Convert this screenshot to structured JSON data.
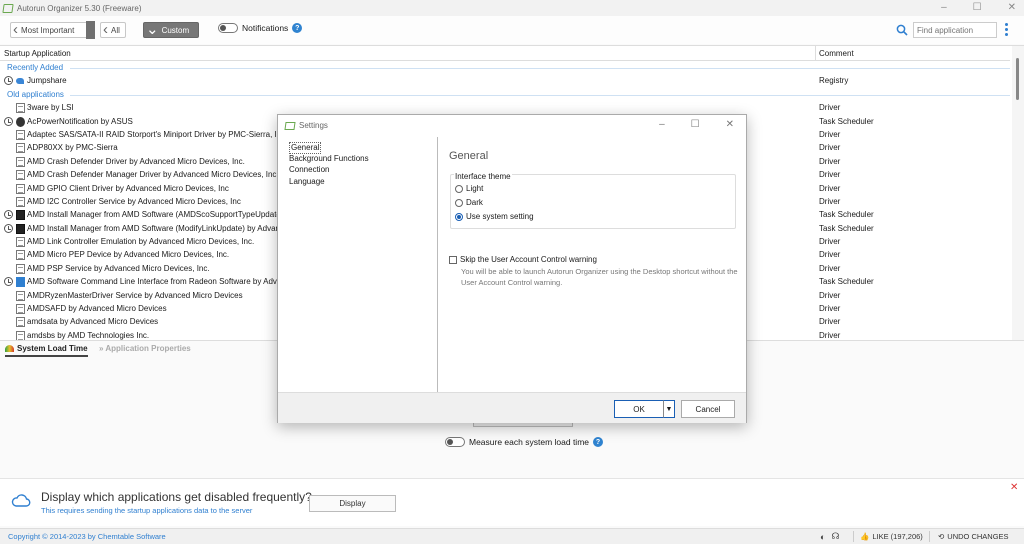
{
  "window": {
    "title": "Autorun Organizer 5.30 (Freeware)",
    "controls": [
      "–",
      "☐",
      "✕"
    ]
  },
  "toolbar": {
    "breadcrumbs": [
      "Most Important",
      "All",
      "Custom"
    ],
    "notifications_label": "Notifications",
    "help_glyph": "?",
    "search_placeholder": "Find application"
  },
  "list": {
    "columns": {
      "name": "Startup Application",
      "comment": "Comment"
    },
    "groups": {
      "recent": "Recently Added",
      "old": "Old applications"
    },
    "recent_items": [
      {
        "name": "Jumpshare",
        "comment": "Registry",
        "icon": "share-icon",
        "clock": true
      }
    ],
    "old_items": [
      {
        "name": "3ware by LSI",
        "comment": "Driver",
        "icon": "file-icon",
        "clock": false
      },
      {
        "name": "AcPowerNotification by ASUS",
        "comment": "Task Scheduler",
        "icon": "hex-icon",
        "clock": true
      },
      {
        "name": "Adaptec SAS/SATA-II RAID Storport's Miniport Driver by PMC-Sierra, Inc.",
        "comment": "Driver",
        "icon": "file-icon",
        "clock": false
      },
      {
        "name": "ADP80XX by PMC-Sierra",
        "comment": "Driver",
        "icon": "file-icon",
        "clock": false
      },
      {
        "name": "AMD Crash Defender Driver by Advanced Micro Devices, Inc.",
        "comment": "Driver",
        "icon": "file-icon",
        "clock": false
      },
      {
        "name": "AMD Crash Defender Manager Driver by Advanced Micro Devices, Inc.",
        "comment": "Driver",
        "icon": "file-icon",
        "clock": false
      },
      {
        "name": "AMD GPIO Client Driver by Advanced Micro Devices, Inc",
        "comment": "Driver",
        "icon": "file-icon",
        "clock": false
      },
      {
        "name": "AMD I2C Controller Service by Advanced Micro Devices, Inc",
        "comment": "Driver",
        "icon": "file-icon",
        "clock": false
      },
      {
        "name": "AMD Install Manager from AMD Software (AMDScoSupportTypeUpdate)",
        "comment": "Task Scheduler",
        "icon": "amd-icon",
        "clock": true
      },
      {
        "name": "AMD Install Manager from AMD Software (ModifyLinkUpdate) by Advanced Micro Devices",
        "comment": "Task Scheduler",
        "icon": "amd-icon",
        "clock": true
      },
      {
        "name": "AMD Link Controller Emulation by Advanced Micro Devices, Inc.",
        "comment": "Driver",
        "icon": "file-icon",
        "clock": false
      },
      {
        "name": "AMD Micro PEP Device by Advanced Micro Devices, Inc.",
        "comment": "Driver",
        "icon": "file-icon",
        "clock": false
      },
      {
        "name": "AMD PSP Service by Advanced Micro Devices, Inc.",
        "comment": "Driver",
        "icon": "file-icon",
        "clock": false
      },
      {
        "name": "AMD Software Command Line Interface from Radeon Software by Advanced Micro Devices",
        "comment": "Task Scheduler",
        "icon": "radeon-icon",
        "clock": true
      },
      {
        "name": "AMDRyzenMasterDriver Service by Advanced Micro Devices",
        "comment": "Driver",
        "icon": "file-icon",
        "clock": false
      },
      {
        "name": "AMDSAFD by Advanced Micro Devices",
        "comment": "Driver",
        "icon": "file-icon",
        "clock": false
      },
      {
        "name": "amdsata by Advanced Micro Devices",
        "comment": "Driver",
        "icon": "file-icon",
        "clock": false
      },
      {
        "name": "amdsbs by AMD Technologies Inc.",
        "comment": "Driver",
        "icon": "file-icon",
        "clock": false
      }
    ]
  },
  "bottom_tabs": {
    "load_time": "System Load Time",
    "properties": "Application Properties"
  },
  "measure": {
    "label": "Measure each system load time"
  },
  "banner": {
    "title": "Display which applications get disabled frequently?",
    "subtitle": "This requires sending the startup applications data to the server",
    "button": "Display",
    "close": "✕"
  },
  "statusbar": {
    "copyright": "Copyright © 2014-2023 by Chemtable Software",
    "like": "LIKE (197,206)",
    "undo": "UNDO CHANGES"
  },
  "dialog": {
    "title": "Settings",
    "nav": [
      "General",
      "Background Functions",
      "Connection",
      "Language"
    ],
    "heading": "General",
    "theme_legend": "Interface theme",
    "theme_options": [
      "Light",
      "Dark",
      "Use system setting"
    ],
    "selected_theme": "Use system setting",
    "skip_uac_label": "Skip the User Account Control warning",
    "skip_uac_desc": "You will be able to launch Autorun Organizer using the Desktop shortcut without the User Account Control warning.",
    "ok": "OK",
    "cancel": "Cancel"
  },
  "colors": {
    "accent": "#2f7fd0",
    "dialog_primary": "#1a5fb4",
    "logo": "#6aa84f"
  }
}
